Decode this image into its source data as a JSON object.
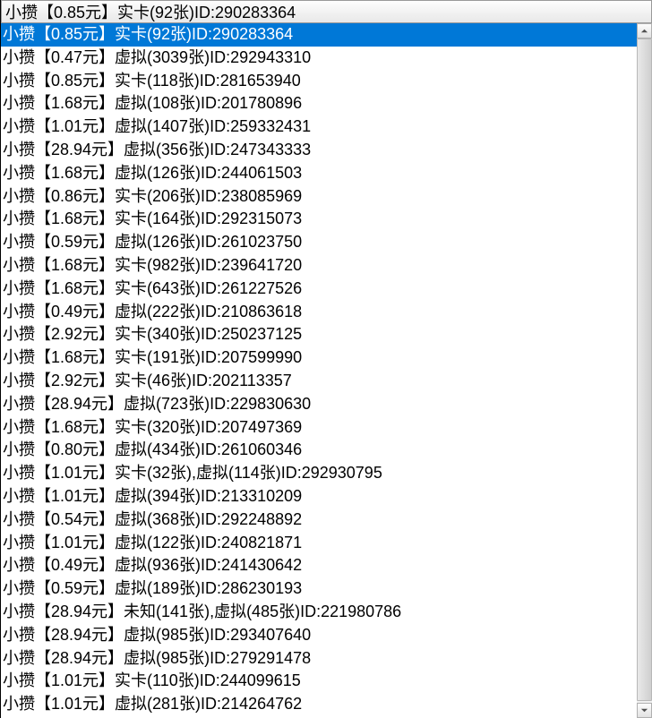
{
  "combo": {
    "value": "小攒【0.85元】实卡(92张)ID:290283364"
  },
  "options": [
    {
      "text": "小攒【0.85元】实卡(92张)ID:290283364",
      "selected": true
    },
    {
      "text": "小攒【0.47元】虚拟(3039张)ID:292943310",
      "selected": false
    },
    {
      "text": "小攒【0.85元】实卡(118张)ID:281653940",
      "selected": false
    },
    {
      "text": "小攒【1.68元】虚拟(108张)ID:201780896",
      "selected": false
    },
    {
      "text": "小攒【1.01元】虚拟(1407张)ID:259332431",
      "selected": false
    },
    {
      "text": "小攒【28.94元】虚拟(356张)ID:247343333",
      "selected": false
    },
    {
      "text": "小攒【1.68元】虚拟(126张)ID:244061503",
      "selected": false
    },
    {
      "text": "小攒【0.86元】实卡(206张)ID:238085969",
      "selected": false
    },
    {
      "text": "小攒【1.68元】实卡(164张)ID:292315073",
      "selected": false
    },
    {
      "text": "小攒【0.59元】虚拟(126张)ID:261023750",
      "selected": false
    },
    {
      "text": "小攒【1.68元】实卡(982张)ID:239641720",
      "selected": false
    },
    {
      "text": "小攒【1.68元】实卡(643张)ID:261227526",
      "selected": false
    },
    {
      "text": "小攒【0.49元】虚拟(222张)ID:210863618",
      "selected": false
    },
    {
      "text": "小攒【2.92元】实卡(340张)ID:250237125",
      "selected": false
    },
    {
      "text": "小攒【1.68元】实卡(191张)ID:207599990",
      "selected": false
    },
    {
      "text": "小攒【2.92元】实卡(46张)ID:202113357",
      "selected": false
    },
    {
      "text": "小攒【28.94元】虚拟(723张)ID:229830630",
      "selected": false
    },
    {
      "text": "小攒【1.68元】实卡(320张)ID:207497369",
      "selected": false
    },
    {
      "text": "小攒【0.80元】虚拟(434张)ID:261060346",
      "selected": false
    },
    {
      "text": "小攒【1.01元】实卡(32张),虚拟(114张)ID:292930795",
      "selected": false
    },
    {
      "text": "小攒【1.01元】虚拟(394张)ID:213310209",
      "selected": false
    },
    {
      "text": "小攒【0.54元】虚拟(368张)ID:292248892",
      "selected": false
    },
    {
      "text": "小攒【1.01元】虚拟(122张)ID:240821871",
      "selected": false
    },
    {
      "text": "小攒【0.49元】虚拟(936张)ID:241430642",
      "selected": false
    },
    {
      "text": "小攒【0.59元】虚拟(189张)ID:286230193",
      "selected": false
    },
    {
      "text": "小攒【28.94元】未知(141张),虚拟(485张)ID:221980786",
      "selected": false
    },
    {
      "text": "小攒【28.94元】虚拟(985张)ID:293407640",
      "selected": false
    },
    {
      "text": "小攒【28.94元】虚拟(985张)ID:279291478",
      "selected": false
    },
    {
      "text": "小攒【1.01元】实卡(110张)ID:244099615",
      "selected": false
    },
    {
      "text": "小攒【1.01元】虚拟(281张)ID:214264762",
      "selected": false
    }
  ]
}
